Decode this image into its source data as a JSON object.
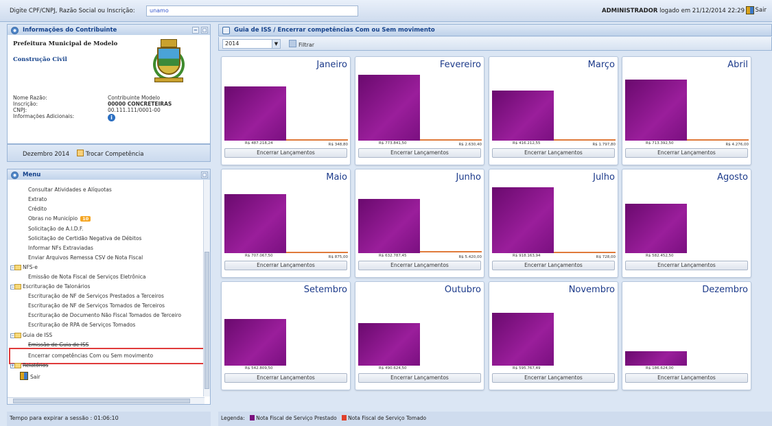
{
  "header": {
    "search_label": "Digite CPF/CNPJ, Razão Social ou Inscrição:",
    "search_value": "unamo",
    "user_name": "ADMINISTRADOR",
    "user_suffix": "logado em 21/12/2014 22:29",
    "exit_label": "Sair"
  },
  "contributor": {
    "panel_title": "Informações do Contribuinte",
    "prefecture": "Prefeitura Municipal de Modelo",
    "category": "Construção Civil",
    "fields": [
      {
        "key": "Nome Razão:",
        "value": "Contribuinte Modelo"
      },
      {
        "key": "Inscrição:",
        "value": "00000 CONCRETEIRAS"
      },
      {
        "key": "CNPJ:",
        "value": "00.111.111/0001-00"
      },
      {
        "key": "Informações Adicionais:",
        "value": ""
      }
    ],
    "competence": "Dezembro 2014",
    "change_competence": "Trocar Competência"
  },
  "menu": {
    "title": "Menu",
    "items": [
      {
        "label": "Consultar Atividades e Alíquotas",
        "type": "item"
      },
      {
        "label": "Extrato",
        "type": "item"
      },
      {
        "label": "Crédito",
        "type": "item"
      },
      {
        "label": "Obras no Município",
        "type": "item",
        "badge": "10"
      },
      {
        "label": "Solicitação de A.I.D.F.",
        "type": "item"
      },
      {
        "label": "Solicitação de Certidão Negativa de Débitos",
        "type": "item"
      },
      {
        "label": "Informar NFs Extraviadas",
        "type": "item"
      },
      {
        "label": "Enviar Arquivos Remessa CSV de Nota Fiscal",
        "type": "item"
      },
      {
        "label": "NFS-e",
        "type": "folder"
      },
      {
        "label": "Emissão de Nota Fiscal de Serviços Eletrônica",
        "type": "item"
      },
      {
        "label": "Escrituração de Talonários",
        "type": "folder"
      },
      {
        "label": "Escrituração de NF de Serviços Prestados a Terceiros",
        "type": "item"
      },
      {
        "label": "Escrituração de NF de Serviços Tomados de Terceiros",
        "type": "item"
      },
      {
        "label": "Escrituração de Documento Não Fiscal Tomados de Terceiro",
        "type": "item"
      },
      {
        "label": "Escrituração de RPA de Serviços Tomados",
        "type": "item"
      },
      {
        "label": "Guia de ISS",
        "type": "folder"
      },
      {
        "label": "Emissão de Guia de ISS",
        "type": "item",
        "strike": true
      },
      {
        "label": "Encerrar competências Com ou Sem movimento",
        "type": "item"
      },
      {
        "label": "Relatórios",
        "type": "folder"
      },
      {
        "label": "Sair",
        "type": "exit"
      }
    ]
  },
  "session": "Tempo para expirar a sessão : 01:06:10",
  "main": {
    "breadcrumb": "Guia de ISS / Encerrar competências Com ou Sem movimento",
    "year": "2014",
    "filter_label": "Filtrar",
    "button_label": "Encerrar Lançamentos",
    "months": [
      {
        "name": "Janeiro",
        "prestado": "R$ 487.218,24",
        "tomado": "R$ 348,80",
        "p_level": 0.82,
        "t_level": 0.02
      },
      {
        "name": "Fevereiro",
        "prestado": "R$ 773.841,50",
        "tomado": "R$ 2.630,40",
        "p_level": 1.0,
        "t_level": 0.02
      },
      {
        "name": "Março",
        "prestado": "R$ 416.212,55",
        "tomado": "R$ 1.797,80",
        "p_level": 0.76,
        "t_level": 0.02
      },
      {
        "name": "Abril",
        "prestado": "R$ 713.392,50",
        "tomado": "R$ 4.276,00",
        "p_level": 0.93,
        "t_level": 0.02
      },
      {
        "name": "Maio",
        "prestado": "R$ 707.067,50",
        "tomado": "R$ 875,00",
        "p_level": 0.9,
        "t_level": 0.02
      },
      {
        "name": "Junho",
        "prestado": "R$ 632.787,45",
        "tomado": "R$ 5.420,00",
        "p_level": 0.82,
        "t_level": 0.03
      },
      {
        "name": "Julho",
        "prestado": "R$ 918.163,94",
        "tomado": "R$ 728,00",
        "p_level": 1.0,
        "t_level": 0.02
      },
      {
        "name": "Agosto",
        "prestado": "R$ 582.452,50",
        "tomado": "",
        "p_level": 0.75,
        "t_level": 0
      },
      {
        "name": "Setembro",
        "prestado": "R$ 542.809,50",
        "tomado": "",
        "p_level": 0.71,
        "t_level": 0
      },
      {
        "name": "Outubro",
        "prestado": "R$ 490.624,50",
        "tomado": "",
        "p_level": 0.65,
        "t_level": 0
      },
      {
        "name": "Novembro",
        "prestado": "R$ 595.767,49",
        "tomado": "",
        "p_level": 0.8,
        "t_level": 0
      },
      {
        "name": "Dezembro",
        "prestado": "R$ 186.624,00",
        "tomado": "",
        "p_level": 0.22,
        "t_level": 0
      }
    ],
    "legend_label": "Legenda:",
    "legend_prestado": "Nota Fiscal de Serviço Prestado",
    "legend_tomado": "Nota Fiscal de Serviço Tomado",
    "colors": {
      "prestado": "#7a0f7e",
      "tomado": "#e0402a"
    }
  }
}
